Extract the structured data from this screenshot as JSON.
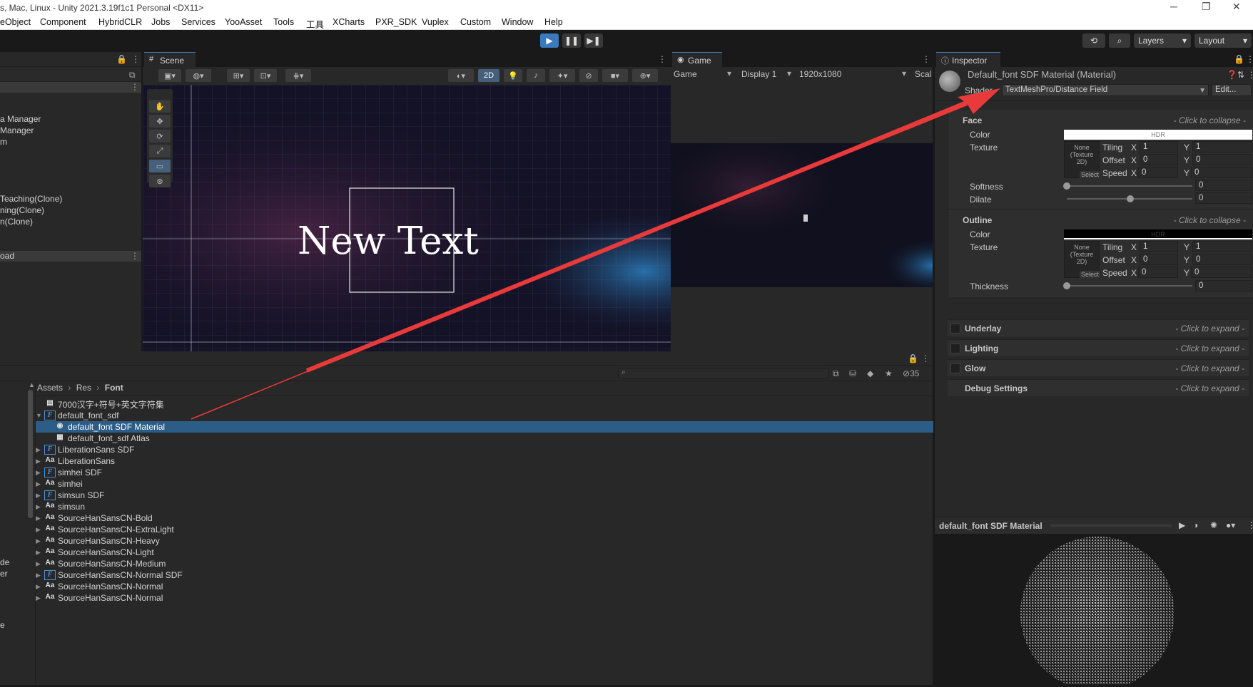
{
  "window": {
    "title": "s, Mac, Linux - Unity 2021.3.19f1c1 Personal <DX11>",
    "minimize": "─",
    "maximize": "❐",
    "close": "✕"
  },
  "menu": [
    "eObject",
    "Component",
    "HybridCLR",
    "Jobs",
    "Services",
    "YooAsset",
    "Tools",
    "工具",
    "XCharts",
    "PXR_SDK",
    "Vuplex",
    "Custom",
    "Window",
    "Help"
  ],
  "toolbar": {
    "layers": "Layers",
    "layout": "Layout"
  },
  "hierarchy": {
    "items": [
      "a Manager",
      "Manager",
      "m",
      "Teaching(Clone)",
      "ning(Clone)",
      "n(Clone)"
    ],
    "section": "oad",
    "side_labels": [
      "de",
      "er",
      "e"
    ]
  },
  "scene": {
    "tab": "Scene",
    "mode_2d": "2D",
    "canvas_text": "New Text"
  },
  "game": {
    "tab": "Game",
    "display_dropdown": "Game",
    "display": "Display 1",
    "resolution": "1920x1080",
    "scale": "Scal"
  },
  "project": {
    "breadcrumb": [
      "Assets",
      "Res",
      "Font"
    ],
    "search_placeholder": "",
    "hidden_count": "35",
    "rows": [
      {
        "icon": "text-file-icon",
        "label": "7000汉字+符号+英文字符集",
        "indent": 0,
        "arrow": ""
      },
      {
        "icon": "font-asset-icon",
        "label": "default_font_sdf",
        "indent": 0,
        "arrow": "▼"
      },
      {
        "icon": "material-icon",
        "label": "default_font SDF Material",
        "indent": 1,
        "arrow": "",
        "selected": true
      },
      {
        "icon": "atlas-icon",
        "label": "default_font_sdf Atlas",
        "indent": 1,
        "arrow": ""
      },
      {
        "icon": "font-asset-icon",
        "label": "LiberationSans SDF",
        "indent": 0,
        "arrow": "▶"
      },
      {
        "icon": "font-icon",
        "label": "LiberationSans",
        "indent": 0,
        "arrow": "▶"
      },
      {
        "icon": "font-asset-icon",
        "label": "simhei SDF",
        "indent": 0,
        "arrow": "▶"
      },
      {
        "icon": "font-icon",
        "label": "simhei",
        "indent": 0,
        "arrow": "▶"
      },
      {
        "icon": "font-asset-icon",
        "label": "simsun SDF",
        "indent": 0,
        "arrow": "▶"
      },
      {
        "icon": "font-icon",
        "label": "simsun",
        "indent": 0,
        "arrow": "▶"
      },
      {
        "icon": "font-icon",
        "label": "SourceHanSansCN-Bold",
        "indent": 0,
        "arrow": "▶"
      },
      {
        "icon": "font-icon",
        "label": "SourceHanSansCN-ExtraLight",
        "indent": 0,
        "arrow": "▶"
      },
      {
        "icon": "font-icon",
        "label": "SourceHanSansCN-Heavy",
        "indent": 0,
        "arrow": "▶"
      },
      {
        "icon": "font-icon",
        "label": "SourceHanSansCN-Light",
        "indent": 0,
        "arrow": "▶"
      },
      {
        "icon": "font-icon",
        "label": "SourceHanSansCN-Medium",
        "indent": 0,
        "arrow": "▶"
      },
      {
        "icon": "font-asset-icon",
        "label": "SourceHanSansCN-Normal SDF",
        "indent": 0,
        "arrow": "▶"
      },
      {
        "icon": "font-icon",
        "label": "SourceHanSansCN-Normal",
        "indent": 0,
        "arrow": "▶"
      },
      {
        "icon": "font-icon",
        "label": "SourceHanSansCN-Normal",
        "indent": 0,
        "arrow": "▶"
      }
    ]
  },
  "inspector": {
    "tab": "Inspector",
    "title": "Default_font SDF Material (Material)",
    "shader_label": "Shader",
    "shader_value": "TextMeshPro/Distance Field",
    "edit_button": "Edit...",
    "face": {
      "name": "Face",
      "hint": "- Click to collapse -",
      "color_label": "Color",
      "hdr": "HDR",
      "texture_label": "Texture",
      "tex_none": "None (Texture 2D)",
      "tex_select": "Select",
      "tiling": "Tiling",
      "offset": "Offset",
      "speed": "Speed",
      "x": "X",
      "y": "Y",
      "tiling_x": "1",
      "tiling_y": "1",
      "offset_x": "0",
      "offset_y": "0",
      "speed_x": "0",
      "speed_y": "0",
      "softness_label": "Softness",
      "softness": "0",
      "dilate_label": "Dilate",
      "dilate": "0"
    },
    "outline": {
      "name": "Outline",
      "hint": "- Click to collapse -",
      "color_label": "Color",
      "hdr": "HDR",
      "texture_label": "Texture",
      "tex_none": "None (Texture 2D)",
      "tex_select": "Select",
      "tiling": "Tiling",
      "offset": "Offset",
      "speed": "Speed",
      "x": "X",
      "y": "Y",
      "tiling_x": "1",
      "tiling_y": "1",
      "offset_x": "0",
      "offset_y": "0",
      "speed_x": "0",
      "speed_y": "0",
      "thickness_label": "Thickness",
      "thickness": "0"
    },
    "collapsed": [
      {
        "name": "Underlay",
        "hint": "- Click to expand -",
        "checkbox": true
      },
      {
        "name": "Lighting",
        "hint": "- Click to expand -",
        "checkbox": true
      },
      {
        "name": "Glow",
        "hint": "- Click to expand -",
        "checkbox": true
      },
      {
        "name": "Debug Settings",
        "hint": "- Click to expand -",
        "checkbox": false
      }
    ],
    "preview_title": "default_font SDF Material"
  },
  "colors": {
    "accent": "#3a79bb",
    "selection": "#2c5d87",
    "arrow": "#e83a3a"
  }
}
